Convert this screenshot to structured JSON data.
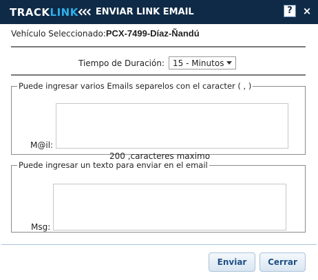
{
  "header": {
    "logo_part1": "TRACK",
    "logo_part2": "LINK",
    "title": "ENVIAR LINK EMAIL",
    "help_label": "?",
    "close_label": "×"
  },
  "vehicle": {
    "label": "Vehículo Seleccionado:",
    "value": "PCX-7499-Díaz-Ñandú"
  },
  "duration": {
    "label": "Tiempo de Duración:",
    "selected": "15 - Minutos"
  },
  "emails": {
    "legend": "Puede ingresar varios Emails separelos con el caracter ( , )",
    "field_label": "M@il:",
    "value": "",
    "counter": "200 ,caracteres maximo"
  },
  "message": {
    "legend": "Puede ingresar un texto para enviar en el email",
    "field_label": "Msg:",
    "value": ""
  },
  "buttons": {
    "send": "Enviar",
    "close": "Cerrar"
  },
  "colors": {
    "titlebar": "#0f2a47",
    "logo_accent": "#2fb0e8",
    "button_text": "#1e4f86"
  }
}
